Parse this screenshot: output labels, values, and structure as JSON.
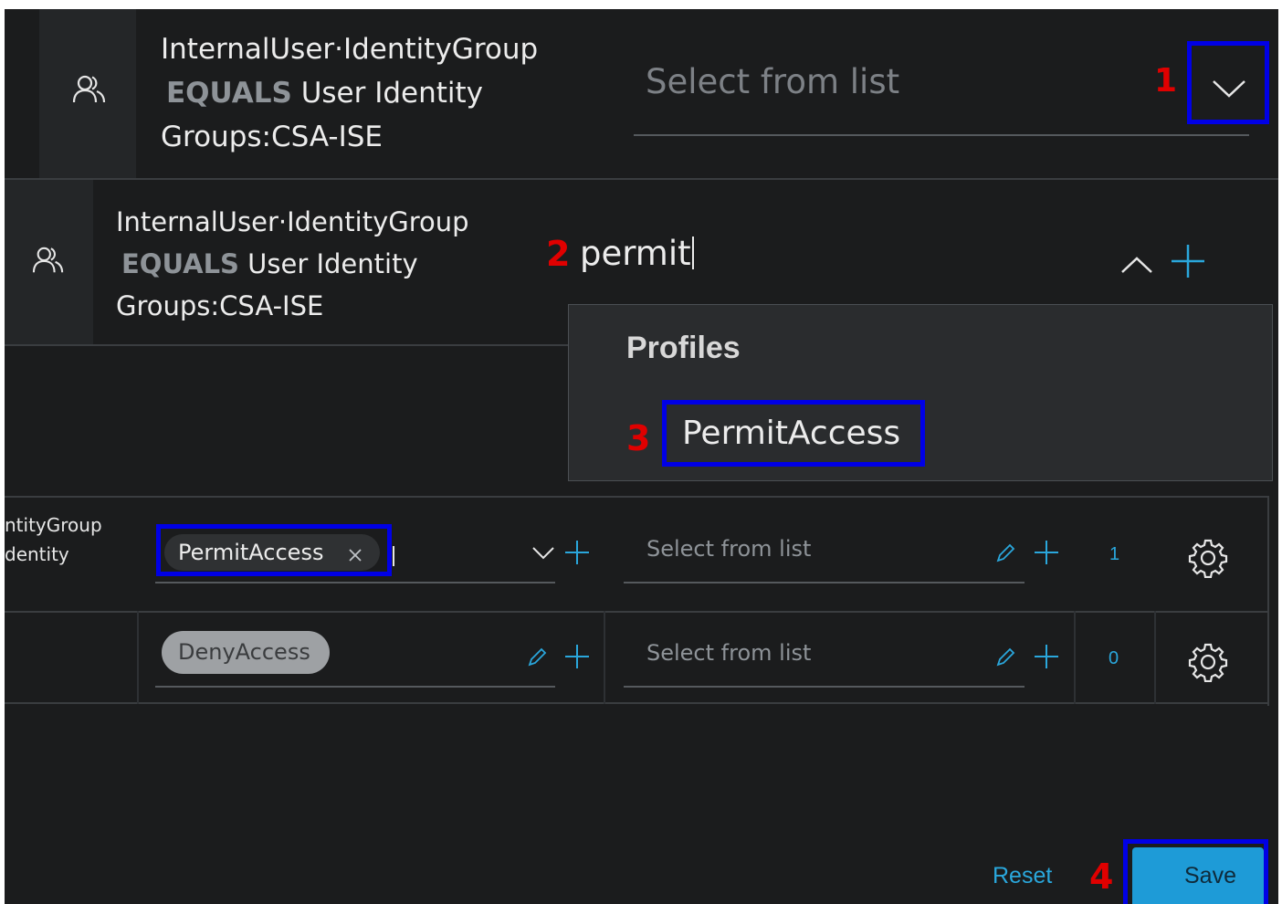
{
  "panel1": {
    "condition": {
      "line1": "InternalUser·IdentityGroup",
      "operator": "EQUALS",
      "line2_rest": "User Identity",
      "line3": "Groups:CSA-ISE"
    },
    "select_placeholder": "Select from list",
    "annotation": "1"
  },
  "panel2": {
    "condition": {
      "line1": "InternalUser·IdentityGroup",
      "operator": "EQUALS",
      "line2_rest": "User Identity",
      "line3": "Groups:CSA-ISE"
    },
    "search_value": "permit",
    "annotation": "2",
    "dropdown": {
      "section_title": "Profiles",
      "option": "PermitAccess",
      "annotation": "3"
    }
  },
  "table": {
    "rows": [
      {
        "condition_fragment_1": "ntityGroup",
        "condition_fragment_2": "dentity",
        "profile_tag": "PermitAccess",
        "security_group_placeholder": "Select from list",
        "hits": "1"
      },
      {
        "profile_tag": "DenyAccess",
        "security_group_placeholder": "Select from list",
        "hits": "0"
      }
    ]
  },
  "footer": {
    "reset_label": "Reset",
    "save_label": "Save",
    "annotation": "4"
  },
  "colors": {
    "background": "#1b1c1d",
    "accent": "#2aa7dc",
    "save_button": "#1e9bd7",
    "annotation_red": "#e00000",
    "highlight_blue": "#0000e6"
  }
}
